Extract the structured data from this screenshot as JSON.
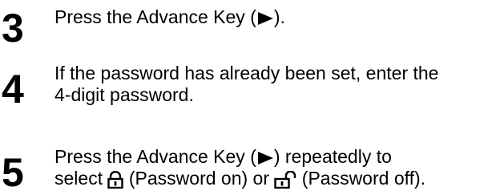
{
  "steps": [
    {
      "number": "3",
      "line1_before": "Press the Advance Key (",
      "line1_after": ").",
      "icon": "advance-key-icon"
    },
    {
      "number": "4",
      "line1": "If the password has already been set, enter the",
      "line2": "4-digit password."
    },
    {
      "number": "5",
      "line1_before": "Press the Advance Key (",
      "line1_after": ") repeatedly to",
      "line2_before": "select ",
      "lock_on_label": " (Password on) or ",
      "lock_off_label": " (Password off).",
      "icons": [
        "advance-key-icon",
        "lock-closed-icon",
        "lock-open-icon"
      ]
    }
  ]
}
